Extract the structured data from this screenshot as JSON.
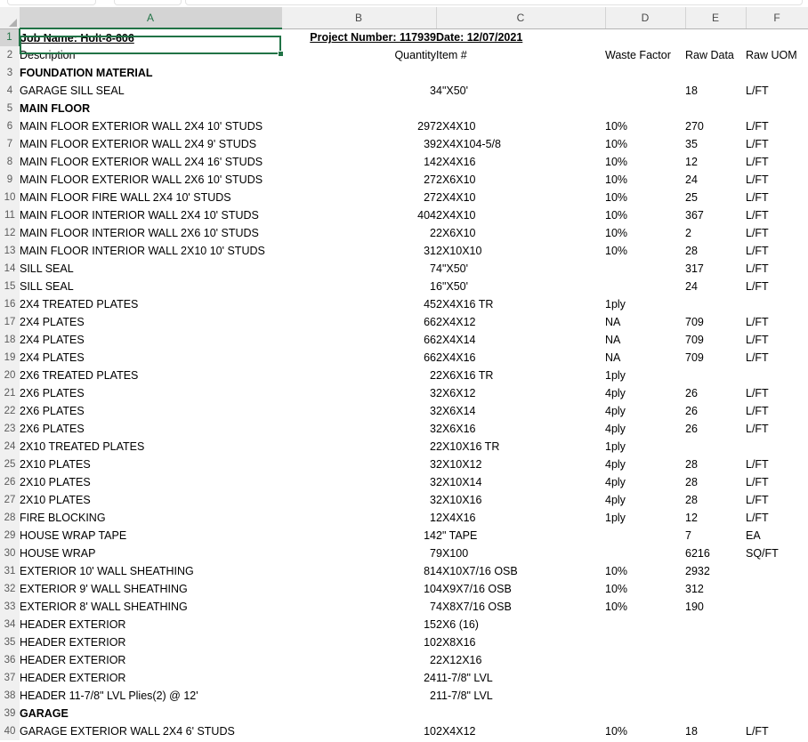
{
  "app": {
    "type": "spreadsheet",
    "active_cell": "A1"
  },
  "ribbon_remnant": {
    "groups": [
      "group-1",
      "group-2",
      "group-3"
    ]
  },
  "columns": [
    {
      "id": "A",
      "label": "A",
      "selected": true
    },
    {
      "id": "B",
      "label": "B",
      "selected": false
    },
    {
      "id": "C",
      "label": "C",
      "selected": false
    },
    {
      "id": "D",
      "label": "D",
      "selected": false
    },
    {
      "id": "E",
      "label": "E",
      "selected": false
    },
    {
      "id": "F",
      "label": "F",
      "selected": false
    }
  ],
  "column_headers": {
    "description": "Description",
    "quantity": "Quantity",
    "item": "Item #",
    "waste_factor": "Waste Factor",
    "raw_data": "Raw Data",
    "raw_uom": "Raw UOM"
  },
  "title_row": {
    "job_name": "Job Name: Holt-8-606",
    "project_number": "Project Number: 117939",
    "date": "Date: 12/07/2021"
  },
  "sheet_rows": [
    {
      "n": 1,
      "A": "Job Name: Holt-8-606",
      "B": "Project Number: 117939",
      "C": "Date: 12/07/2021",
      "D": "",
      "E": "",
      "F": "",
      "style": "title"
    },
    {
      "n": 2,
      "A": "Description",
      "B": "Quantity",
      "C": "Item #",
      "D": "Waste Factor",
      "E": "Raw Data",
      "F": "Raw UOM",
      "style": "header"
    },
    {
      "n": 3,
      "A": "FOUNDATION MATERIAL",
      "B": "",
      "C": "",
      "D": "",
      "E": "",
      "F": "",
      "style": "section"
    },
    {
      "n": 4,
      "A": "GARAGE SILL SEAL",
      "B": "3",
      "C": "4\"X50'",
      "D": "",
      "E": "18",
      "F": "L/FT",
      "style": "data"
    },
    {
      "n": 5,
      "A": "MAIN FLOOR",
      "B": "",
      "C": "",
      "D": "",
      "E": "",
      "F": "",
      "style": "section"
    },
    {
      "n": 6,
      "A": "MAIN FLOOR EXTERIOR WALL 2X4 10' STUDS",
      "B": "297",
      "C": "2X4X10",
      "D": "10%",
      "E": "270",
      "F": "L/FT",
      "style": "data"
    },
    {
      "n": 7,
      "A": "MAIN FLOOR EXTERIOR WALL 2X4 9' STUDS",
      "B": "39",
      "C": "2X4X104-5/8",
      "D": "10%",
      "E": "35",
      "F": "L/FT",
      "style": "data"
    },
    {
      "n": 8,
      "A": "MAIN FLOOR EXTERIOR WALL 2X4 16' STUDS",
      "B": "14",
      "C": "2X4X16",
      "D": "10%",
      "E": "12",
      "F": "L/FT",
      "style": "data"
    },
    {
      "n": 9,
      "A": "MAIN FLOOR EXTERIOR WALL 2X6 10' STUDS",
      "B": "27",
      "C": "2X6X10",
      "D": "10%",
      "E": "24",
      "F": "L/FT",
      "style": "data"
    },
    {
      "n": 10,
      "A": "MAIN FLOOR FIRE WALL 2X4 10' STUDS",
      "B": "27",
      "C": "2X4X10",
      "D": "10%",
      "E": "25",
      "F": "L/FT",
      "style": "data"
    },
    {
      "n": 11,
      "A": "MAIN FLOOR INTERIOR WALL 2X4 10' STUDS",
      "B": "404",
      "C": "2X4X10",
      "D": "10%",
      "E": "367",
      "F": "L/FT",
      "style": "data"
    },
    {
      "n": 12,
      "A": "MAIN FLOOR INTERIOR WALL 2X6 10' STUDS",
      "B": "2",
      "C": "2X6X10",
      "D": "10%",
      "E": "2",
      "F": "L/FT",
      "style": "data"
    },
    {
      "n": 13,
      "A": "MAIN FLOOR INTERIOR WALL 2X10 10' STUDS",
      "B": "31",
      "C": "2X10X10",
      "D": "10%",
      "E": "28",
      "F": "L/FT",
      "style": "data"
    },
    {
      "n": 14,
      "A": "SILL SEAL",
      "B": "7",
      "C": "4\"X50'",
      "D": "",
      "E": "317",
      "F": "L/FT",
      "style": "data"
    },
    {
      "n": 15,
      "A": "SILL SEAL",
      "B": "1",
      "C": "6\"X50'",
      "D": "",
      "E": "24",
      "F": "L/FT",
      "style": "data"
    },
    {
      "n": 16,
      "A": "2X4 TREATED PLATES",
      "B": "45",
      "C": "2X4X16 TR",
      "D": "1ply",
      "E": "",
      "F": "",
      "style": "data"
    },
    {
      "n": 17,
      "A": "2X4 PLATES",
      "B": "66",
      "C": "2X4X12",
      "D": "NA",
      "E": "709",
      "F": "L/FT",
      "style": "data"
    },
    {
      "n": 18,
      "A": "2X4 PLATES",
      "B": "66",
      "C": "2X4X14",
      "D": "NA",
      "E": "709",
      "F": "L/FT",
      "style": "data"
    },
    {
      "n": 19,
      "A": "2X4 PLATES",
      "B": "66",
      "C": "2X4X16",
      "D": "NA",
      "E": "709",
      "F": "L/FT",
      "style": "data"
    },
    {
      "n": 20,
      "A": "2X6 TREATED PLATES",
      "B": "2",
      "C": "2X6X16 TR",
      "D": "1ply",
      "E": "",
      "F": "",
      "style": "data"
    },
    {
      "n": 21,
      "A": "2X6 PLATES",
      "B": "3",
      "C": "2X6X12",
      "D": "4ply",
      "E": "26",
      "F": "L/FT",
      "style": "data"
    },
    {
      "n": 22,
      "A": "2X6 PLATES",
      "B": "3",
      "C": "2X6X14",
      "D": "4ply",
      "E": "26",
      "F": "L/FT",
      "style": "data"
    },
    {
      "n": 23,
      "A": "2X6 PLATES",
      "B": "3",
      "C": "2X6X16",
      "D": "4ply",
      "E": "26",
      "F": "L/FT",
      "style": "data"
    },
    {
      "n": 24,
      "A": "2X10 TREATED PLATES",
      "B": "2",
      "C": "2X10X16 TR",
      "D": "1ply",
      "E": "",
      "F": "",
      "style": "data"
    },
    {
      "n": 25,
      "A": "2X10 PLATES",
      "B": "3",
      "C": "2X10X12",
      "D": "4ply",
      "E": "28",
      "F": "L/FT",
      "style": "data"
    },
    {
      "n": 26,
      "A": "2X10 PLATES",
      "B": "3",
      "C": "2X10X14",
      "D": "4ply",
      "E": "28",
      "F": "L/FT",
      "style": "data"
    },
    {
      "n": 27,
      "A": "2X10 PLATES",
      "B": "3",
      "C": "2X10X16",
      "D": "4ply",
      "E": "28",
      "F": "L/FT",
      "style": "data"
    },
    {
      "n": 28,
      "A": "FIRE BLOCKING",
      "B": "1",
      "C": "2X4X16",
      "D": "1ply",
      "E": "12",
      "F": "L/FT",
      "style": "data"
    },
    {
      "n": 29,
      "A": "HOUSE WRAP TAPE",
      "B": "14",
      "C": "2\" TAPE",
      "D": "",
      "E": "7",
      "F": "EA",
      "style": "data"
    },
    {
      "n": 30,
      "A": "HOUSE WRAP",
      "B": "7",
      "C": "9X100",
      "D": "",
      "E": "6216",
      "F": "SQ/FT",
      "style": "data"
    },
    {
      "n": 31,
      "A": "EXTERIOR 10' WALL SHEATHING",
      "B": "81",
      "C": "4X10X7/16 OSB",
      "D": "10%",
      "E": "2932",
      "F": "",
      "style": "data"
    },
    {
      "n": 32,
      "A": "EXTERIOR 9' WALL SHEATHING",
      "B": "10",
      "C": "4X9X7/16 OSB",
      "D": "10%",
      "E": "312",
      "F": "",
      "style": "data"
    },
    {
      "n": 33,
      "A": "EXTERIOR 8' WALL SHEATHING",
      "B": "7",
      "C": "4X8X7/16 OSB",
      "D": "10%",
      "E": "190",
      "F": "",
      "style": "data"
    },
    {
      "n": 34,
      "A": "HEADER EXTERIOR",
      "B": "15",
      "C": "2X6 (16)",
      "D": "",
      "E": "",
      "F": "",
      "style": "data"
    },
    {
      "n": 35,
      "A": "HEADER EXTERIOR",
      "B": "10",
      "C": "2X8X16",
      "D": "",
      "E": "",
      "F": "",
      "style": "data"
    },
    {
      "n": 36,
      "A": "HEADER EXTERIOR",
      "B": "2",
      "C": "2X12X16",
      "D": "",
      "E": "",
      "F": "",
      "style": "data"
    },
    {
      "n": 37,
      "A": "HEADER EXTERIOR",
      "B": "24",
      "C": "11-7/8\" LVL",
      "D": "",
      "E": "",
      "F": "",
      "style": "data"
    },
    {
      "n": 38,
      "A": "HEADER 11-7/8\" LVL Plies(2) @ 12'",
      "B": "2",
      "C": "11-7/8\" LVL",
      "D": "",
      "E": "",
      "F": "",
      "style": "data"
    },
    {
      "n": 39,
      "A": "GARAGE",
      "B": "",
      "C": "",
      "D": "",
      "E": "",
      "F": "",
      "style": "section"
    },
    {
      "n": 40,
      "A": "GARAGE EXTERIOR WALL 2X4 6' STUDS",
      "B": "10",
      "C": "2X4X12",
      "D": "10%",
      "E": "18",
      "F": "L/FT",
      "style": "data"
    }
  ],
  "colors": {
    "accent_green": "#217346",
    "header_gray": "#f0f0f0",
    "selected_header_gray": "#d4d4d4",
    "gridline": "#d4d4d4"
  }
}
